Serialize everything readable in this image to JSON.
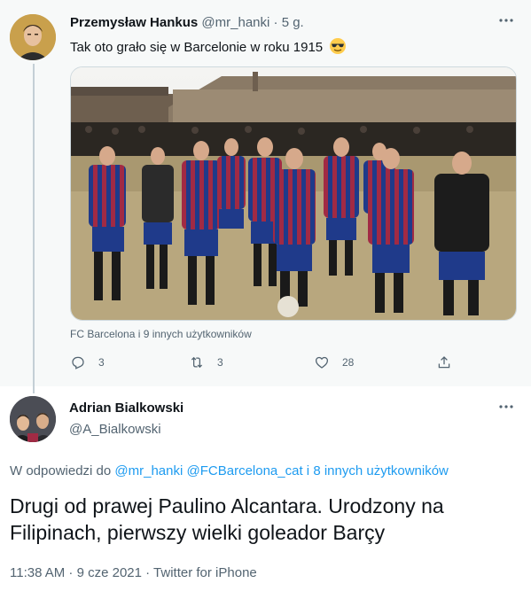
{
  "parent_tweet": {
    "author_name": "Przemysław Hankus",
    "handle": "@mr_hanki",
    "separator": "·",
    "time": "5 g.",
    "text": "Tak oto grało się w Barcelonie w roku 1915",
    "emoji": "smiling-face-with-sunglasses",
    "tagged": "FC Barcelona i 9 innych użytkowników",
    "actions": {
      "reply_count": "3",
      "retweet_count": "3",
      "like_count": "28"
    }
  },
  "reply_tweet": {
    "author_name": "Adrian Bialkowski",
    "handle": "@A_Bialkowski",
    "reply_to": {
      "prefix": "W odpowiedzi do",
      "mention1": "@mr_hanki",
      "mention2": "@FCBarcelona_cat",
      "conjunction": "i",
      "others": "8 innych użytkowników"
    },
    "text": "Drugi od prawej Paulino Alcantara. Urodzony na Filipinach, pierwszy wielki goleador Barçy",
    "meta": "11:38 AM · 9 cze 2021 · Twitter for iPhone"
  },
  "colors": {
    "accent": "#1d9bf0",
    "muted": "#536471",
    "parent_bg": "#f7f9f9",
    "blaugrana_blue": "#1f3a8a",
    "blaugrana_red": "#a12a44"
  }
}
